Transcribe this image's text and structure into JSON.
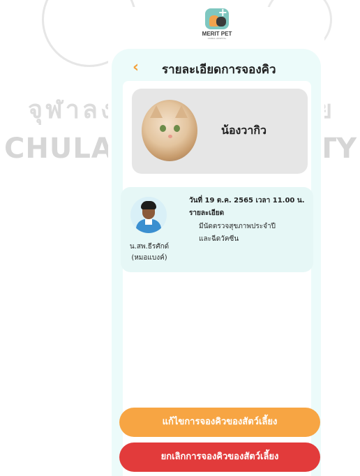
{
  "watermark": {
    "line_th": "จุฬาลงกรณ์",
    "line_th_right": "ย",
    "line_en": "CHULALO",
    "line_en_right": "ITY"
  },
  "logo": {
    "name": "MERIT PET",
    "subtitle": "ANIMAL HOSPITAL"
  },
  "header": {
    "back_icon": "‹",
    "title": "รายละเอียดการจองคิว"
  },
  "pet": {
    "name": "น้องวากิว"
  },
  "appointment": {
    "datetime": "วันที่ 19 ต.ค. 2565 เวลา 11.00 น.",
    "detail_label": "รายละเอียด",
    "detail_line1": "มีนัดตรวจสุขภาพประจำปี",
    "detail_line2": "และฉีดวัคซีน",
    "vet_name_line1": "น.สพ.ธีรศักด์",
    "vet_name_line2": "(หมอแบงค์)"
  },
  "buttons": {
    "edit_label": "แก้ไขการจองคิวของสัตว์เลี้ยง",
    "cancel_label": "ยกเลิกการจองคิวของสัตว์เลี้ยง"
  },
  "colors": {
    "accent_orange": "#f7a543",
    "danger_red": "#e23b3b",
    "panel_mint": "#ecfbfa"
  }
}
